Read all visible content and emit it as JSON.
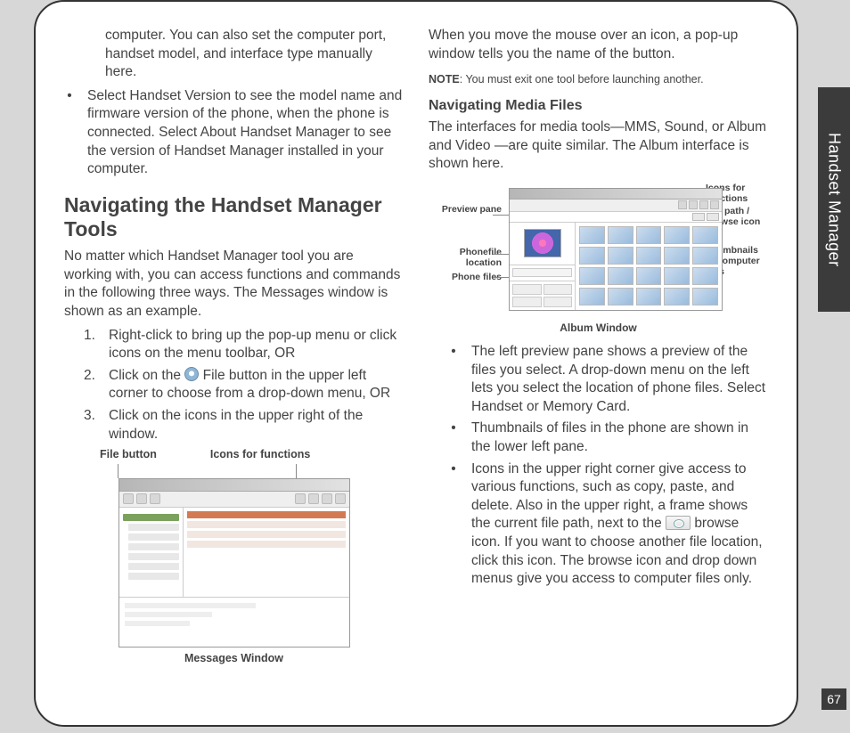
{
  "side_tab": "Handset Manager",
  "page_number": "67",
  "left": {
    "intro_cont": "computer. You can also set the computer port, handset model, and interface type manually here.",
    "bullet1": "Select Handset Version to see the model name and firmware version of the phone, when the phone is connected. Select About Handset Manager to see the version of Handset Manager installed in your computer.",
    "h2": "Navigating the Handset Manager Tools",
    "para": "No matter which Handset Manager tool you are working with, you can access functions and commands in the following three ways. The Messages window is shown as an example.",
    "steps": {
      "s1": "Right-click to bring up the pop-up menu or click icons on the menu toolbar, OR",
      "s2a": "Click on the ",
      "s2b": " File button in the upper left corner to choose from a drop-down menu, OR",
      "s3": "Click on the icons in the upper right of the window."
    },
    "fig1": {
      "label_a": "File button",
      "label_b": "Icons for functions",
      "caption": "Messages Window"
    }
  },
  "right": {
    "para1": "When you move the mouse over an icon, a pop-up window tells you the name of the button.",
    "note_label": "NOTE",
    "note_text": ": You must exit one tool before launching another.",
    "h3": "Navigating Media Files",
    "para2": "The interfaces for media tools—MMS, Sound, or Album and Video —are quite similar. The Album interface is shown here.",
    "fig2": {
      "l_preview": "Preview pane",
      "l_loc": "Phonefile location",
      "l_phone": "Phone files",
      "r_icons": "Icons for functions",
      "r_path": "File path / browse icon",
      "r_thumbs": "Thumbnails of computer files",
      "caption": "Album Window"
    },
    "bullets": {
      "b1": "The left preview pane shows a preview of the files you select. A drop-down menu on the left lets you select the location of phone files. Select Handset or Memory Card.",
      "b2": "Thumbnails of files in the phone are shown in the lower left pane.",
      "b3a": "Icons in the upper right corner give access to various functions, such as copy, paste, and delete. Also in the upper right, a frame shows the current file path, next to the ",
      "b3b": " browse icon. If you want to choose another file location, click this icon. The browse icon and drop down menus give you access to computer files only."
    }
  }
}
